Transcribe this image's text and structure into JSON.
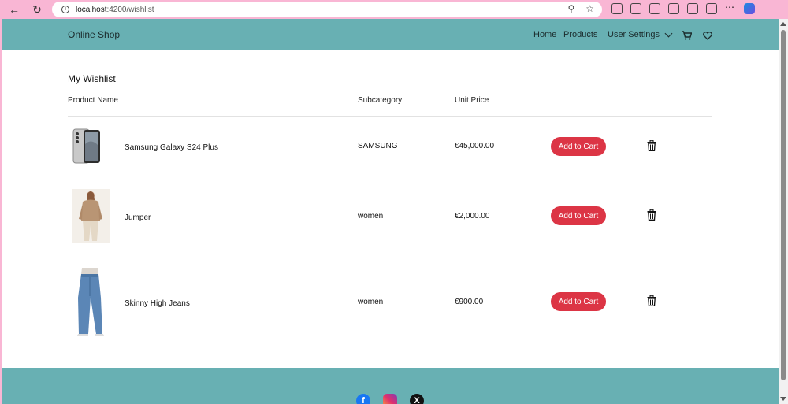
{
  "browser": {
    "url_host": "localhost",
    "url_path": ":4200/wishlist"
  },
  "header": {
    "brand": "Online Shop",
    "nav": {
      "home": "Home",
      "products": "Products",
      "user_settings": "User Settings"
    }
  },
  "wishlist": {
    "title": "My Wishlist",
    "columns": {
      "name": "Product Name",
      "subcategory": "Subcategory",
      "price": "Unit Price"
    },
    "items": [
      {
        "name": "Samsung Galaxy S24 Plus",
        "subcategory": "SAMSUNG",
        "price": "€45,000.00",
        "action": "Add to Cart"
      },
      {
        "name": "Jumper",
        "subcategory": "women",
        "price": "€2,000.00",
        "action": "Add to Cart"
      },
      {
        "name": "Skinny High Jeans",
        "subcategory": "women",
        "price": "€900.00",
        "action": "Add to Cart"
      }
    ]
  },
  "colors": {
    "header_bg": "#68b0b3",
    "button_bg": "#dc3545"
  }
}
